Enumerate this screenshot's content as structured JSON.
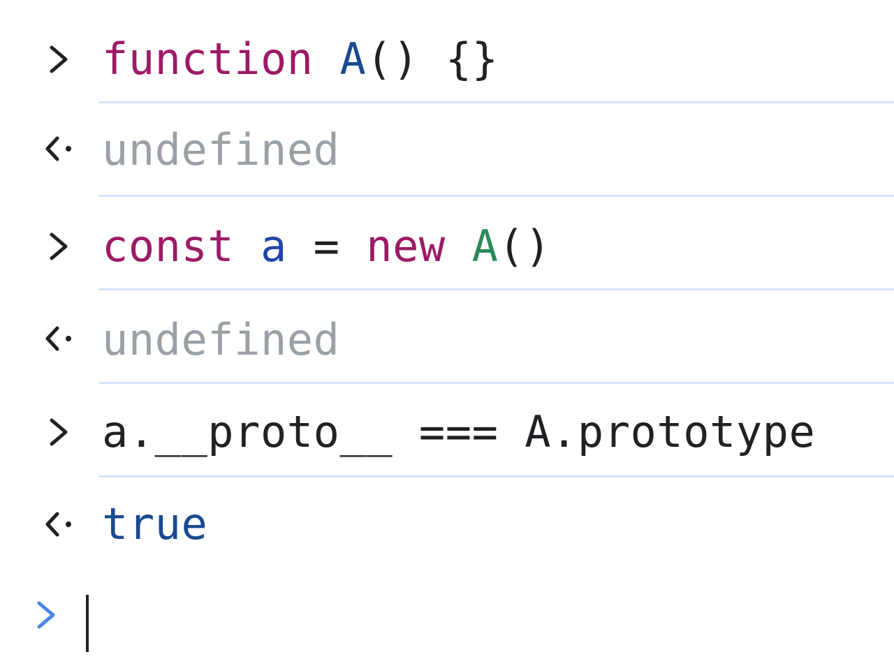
{
  "entries": [
    {
      "kind": "input",
      "tokens": [
        {
          "text": "function",
          "role": "keyword"
        },
        {
          "text": " ",
          "role": "space"
        },
        {
          "text": "A",
          "role": "function-name"
        },
        {
          "text": "()",
          "role": "punct"
        },
        {
          "text": " ",
          "role": "space"
        },
        {
          "text": "{}",
          "role": "punct"
        }
      ]
    },
    {
      "kind": "result",
      "text": "undefined"
    },
    {
      "kind": "input",
      "tokens": [
        {
          "text": "const",
          "role": "keyword"
        },
        {
          "text": " ",
          "role": "space"
        },
        {
          "text": "a",
          "role": "variable"
        },
        {
          "text": " = ",
          "role": "operator"
        },
        {
          "text": "new",
          "role": "keyword"
        },
        {
          "text": " ",
          "role": "space"
        },
        {
          "text": "A",
          "role": "constructor"
        },
        {
          "text": "()",
          "role": "punct"
        }
      ]
    },
    {
      "kind": "result",
      "text": "undefined"
    },
    {
      "kind": "input",
      "tokens": [
        {
          "text": "a.__proto__ === A.prototype",
          "role": "plain"
        }
      ]
    },
    {
      "kind": "result",
      "text": "true"
    }
  ],
  "colors": {
    "keyword": "#9c1a65",
    "function_name": "#1a4a8f",
    "constructor": "#2b8a5a",
    "variable": "#2244aa",
    "undefined": "#9aa0a6",
    "boolean": "#1a4a8f",
    "separator": "#d3e3fd",
    "active_prompt": "#4a86e8",
    "prompt": "#202124"
  },
  "icons": {
    "input_prompt": "chevron-right-icon",
    "result_marker": "return-arrow-icon",
    "active_prompt": "chevron-right-icon"
  }
}
